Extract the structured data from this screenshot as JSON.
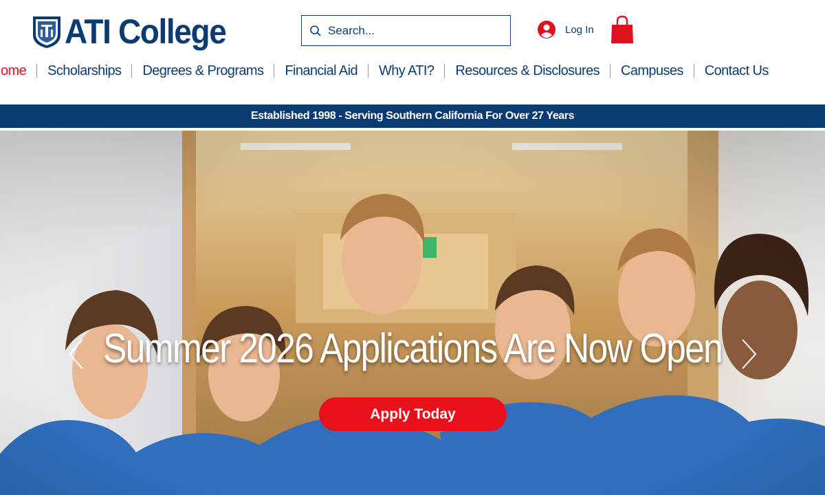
{
  "header": {
    "logo_text": "ATI College",
    "logo_seal": "shield-seal-icon",
    "search": {
      "placeholder": "Search..."
    },
    "login_label": "Log In",
    "cart_icon": "shopping-bag-icon"
  },
  "nav": {
    "items": [
      "ome",
      "Scholarships",
      "Degrees & Programs",
      "Financial Aid",
      "Why ATI?",
      "Resources & Disclosures",
      "Campuses",
      "Contact Us"
    ]
  },
  "banner": {
    "text": "Established 1998 - Serving Southern California For Over 27 Years"
  },
  "hero": {
    "title": "Summer 2026 Applications Are Now Open",
    "cta_label": "Apply Today"
  },
  "colors": {
    "brand_navy": "#0b3b73",
    "accent_red": "#e8111b",
    "active_nav": "#e0111c"
  }
}
